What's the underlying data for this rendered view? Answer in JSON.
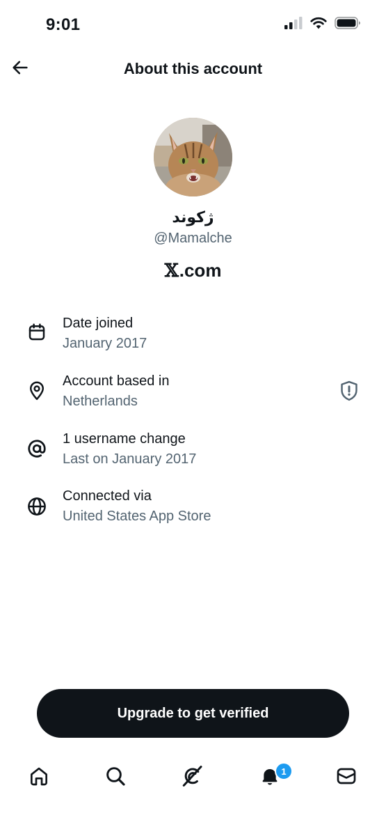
{
  "status_bar": {
    "time": "9:01",
    "icons": [
      "cellular-signal-icon",
      "wifi-icon",
      "battery-icon"
    ]
  },
  "header": {
    "title": "About this account",
    "back_icon": "arrow-left-icon"
  },
  "profile": {
    "display_name": "ژکوند",
    "handle": "@Mamalche",
    "site_logo": "𝕏",
    "site_suffix": ".com"
  },
  "info": {
    "date_joined": {
      "label": "Date joined",
      "value": "January 2017",
      "icon": "calendar-icon"
    },
    "based_in": {
      "label": "Account based in",
      "value": "Netherlands",
      "icon": "location-pin-icon",
      "action_icon": "shield-exclamation-icon"
    },
    "username": {
      "label": "1 username change",
      "value": "Last on January 2017",
      "icon": "at-sign-icon"
    },
    "connected": {
      "label": "Connected via",
      "value": "United States App Store",
      "icon": "globe-icon"
    }
  },
  "upgrade_button": "Upgrade to get verified",
  "tabbar": {
    "tabs": [
      "home-icon",
      "search-icon",
      "grok-icon",
      "notifications-bell-icon",
      "messages-icon"
    ],
    "notification_count": "1"
  },
  "colors": {
    "text_primary": "#0f1419",
    "text_secondary": "#536471",
    "accent": "#1d9bf0",
    "button_bg": "#0f1419"
  }
}
